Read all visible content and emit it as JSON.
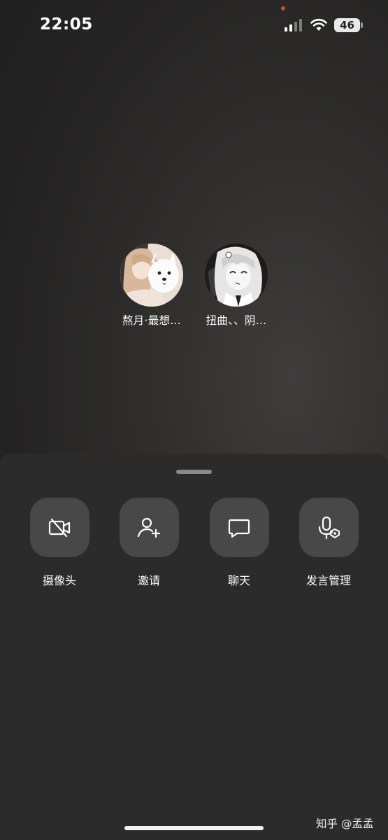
{
  "status_bar": {
    "time": "22:05",
    "battery": "46"
  },
  "participants": [
    {
      "name": "熬月·最想…",
      "avatar": "anime-girl-with-white-dog"
    },
    {
      "name": "扭曲、、阴…",
      "avatar": "monochrome-anime-girl"
    }
  ],
  "actions": {
    "camera_label": "摄像头",
    "invite_label": "邀请",
    "chat_label": "聊天",
    "mic_manage_label": "发言管理"
  },
  "watermark": "知乎 @孟孟",
  "colors": {
    "background": "#222222",
    "sheet": "#2b2b2b",
    "button": "#484848",
    "text": "#ffffff",
    "recording_dot": "#e0453a"
  },
  "icons": [
    "signal-icon",
    "wifi-icon",
    "camera-off-icon",
    "add-user-icon",
    "chat-bubble-icon",
    "mic-shield-icon"
  ]
}
